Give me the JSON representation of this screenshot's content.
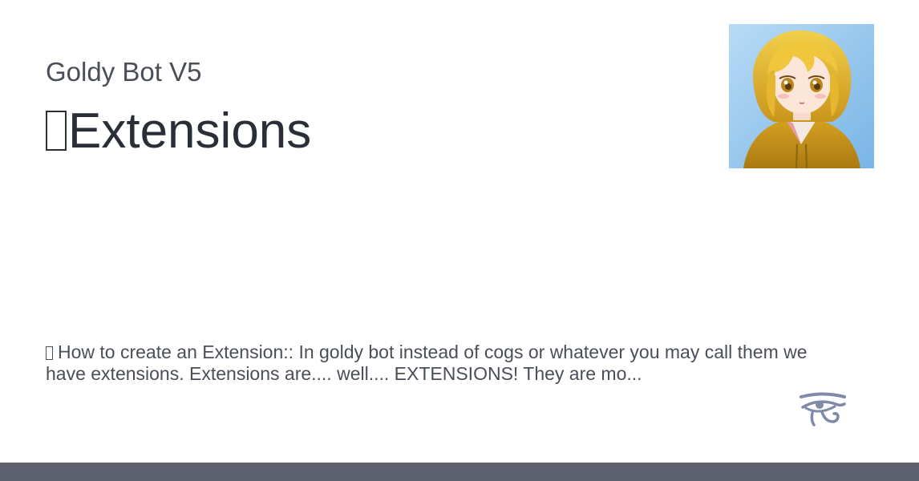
{
  "card": {
    "site_name": "Goldy Bot V5",
    "title": "Extensions",
    "description": "How to create an Extension:: In goldy bot instead of cogs or whatever you may call them we have extensions. Extensions are.... well.... EXTENSIONS! They are mo...",
    "avatar_icon": "anime-girl-avatar",
    "logo_icon": "eye-of-horus-icon"
  },
  "colors": {
    "background": "#ffffff",
    "text_primary": "#2a2f37",
    "text_secondary": "#4a4f57",
    "footer_bar": "#5c616d",
    "logo": "#7e8aa8"
  }
}
